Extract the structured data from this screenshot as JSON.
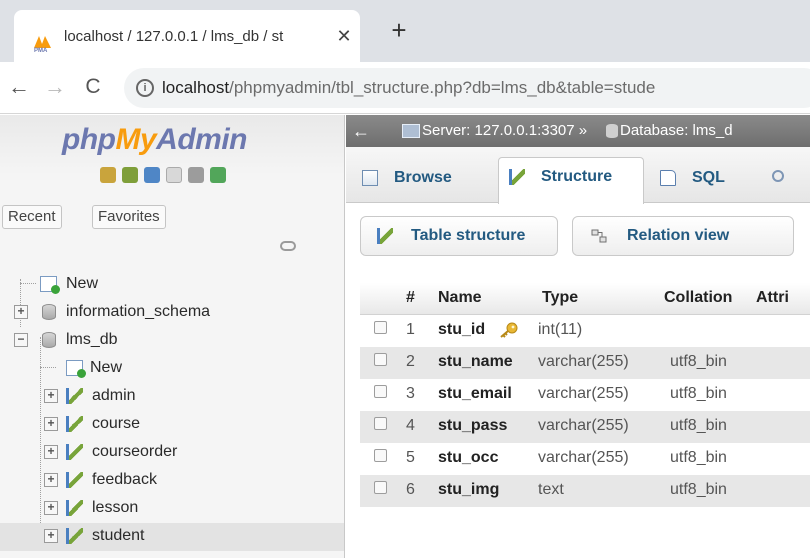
{
  "browser": {
    "tab_title": "localhost / 127.0.0.1 / lms_db / st",
    "url_host": "localhost",
    "url_path": "/phpmyadmin/tbl_structure.php?db=lms_db&table=stude",
    "close_glyph": "✕",
    "new_tab_glyph": "+",
    "back_glyph": "←",
    "forward_glyph": "→",
    "reload_glyph": "C",
    "info_glyph": "i"
  },
  "sidebar": {
    "logo": {
      "php": "php",
      "my": "My",
      "admin": "Admin"
    },
    "icons": [
      "home-icon",
      "database-icon",
      "help-icon",
      "docs-icon",
      "settings-icon",
      "reload-icon"
    ],
    "recent_label": "Recent",
    "favorites_label": "Favorites",
    "tree": {
      "new_root": "New",
      "information_schema": "information_schema",
      "lms_db": "lms_db",
      "new_table": "New",
      "tables": [
        "admin",
        "course",
        "courseorder",
        "feedback",
        "lesson",
        "student"
      ]
    },
    "expander_plus": "+",
    "expander_minus": "−"
  },
  "main": {
    "collapse_glyph": "←",
    "breadcrumb_server": "Server: 127.0.0.1:3307 »",
    "breadcrumb_database": "Database: lms_d",
    "tabs": [
      "Browse",
      "Structure",
      "SQL"
    ],
    "sub_buttons": [
      "Table structure",
      "Relation view"
    ],
    "columns": [
      "#",
      "Name",
      "Type",
      "Collation",
      "Attri"
    ],
    "rows": [
      {
        "num": "1",
        "name": "stu_id",
        "type": "int(11)",
        "collation": ""
      },
      {
        "num": "2",
        "name": "stu_name",
        "type": "varchar(255)",
        "collation": "utf8_bin"
      },
      {
        "num": "3",
        "name": "stu_email",
        "type": "varchar(255)",
        "collation": "utf8_bin"
      },
      {
        "num": "4",
        "name": "stu_pass",
        "type": "varchar(255)",
        "collation": "utf8_bin"
      },
      {
        "num": "5",
        "name": "stu_occ",
        "type": "varchar(255)",
        "collation": "utf8_bin"
      },
      {
        "num": "6",
        "name": "stu_img",
        "type": "text",
        "collation": "utf8_bin"
      }
    ]
  },
  "colors": {
    "brand_blue": "#6c78af",
    "brand_orange": "#f89c0e",
    "link": "#235a81",
    "server_bar": "#7a7a7a",
    "row_alt": "#e7e7e7"
  }
}
